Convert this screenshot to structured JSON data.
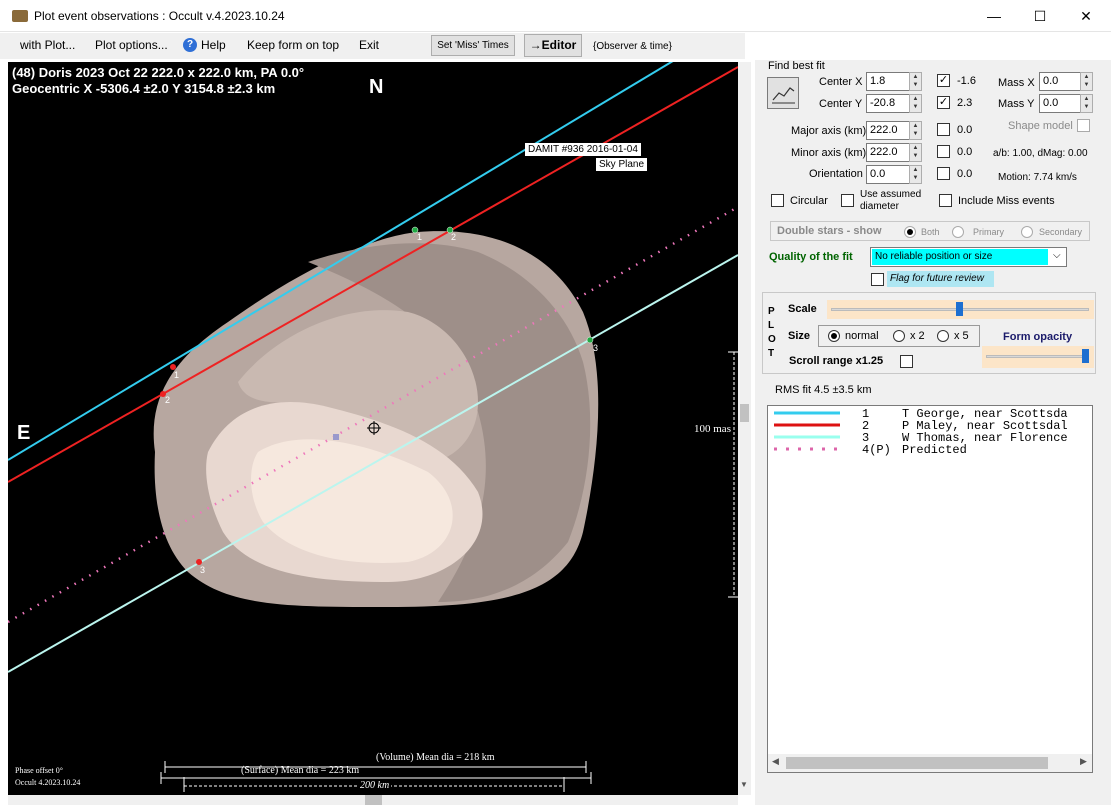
{
  "window": {
    "title": "Plot event observations : Occult v.4.2023.10.24",
    "minimize_glyph": "—",
    "maximize_glyph": "☐",
    "close_glyph": "✕"
  },
  "menu": {
    "with_plot": "with Plot...",
    "plot_options": "Plot options...",
    "help": "Help",
    "keep_on_top": "Keep form on top",
    "exit": "Exit",
    "set_miss_times": "Set 'Miss' Times",
    "editor": "→Editor",
    "observer_time": "{Observer & time}"
  },
  "plot": {
    "header_line1": "(48) Doris  2023 Oct 22   222.0 x 222.0 km, PA 0.0°",
    "header_line2": "Geocentric  X  -5306.4 ±2.0  Y 3154.8 ±2.3 km",
    "north": "N",
    "east": "E",
    "damit_label": "DAMIT #936 2016-01-04",
    "sky_plane": "Sky Plane",
    "scale_label": "100 mas",
    "volume_dia": "(Volume) Mean dia = 218 km",
    "surface_dia": "(Surface) Mean dia = 223 km",
    "km_scale": "200 km",
    "phase_offset": "Phase offset 0°",
    "version": "Occult 4.2023.10.24",
    "chord_labels": [
      "1",
      "2",
      "1",
      "2",
      "3",
      "3"
    ]
  },
  "fit": {
    "find_best_fit": "Find best fit",
    "center_x_label": "Center X",
    "center_x": "1.8",
    "center_y_label": "Center Y",
    "center_y": "-20.8",
    "cx_check": "-1.6",
    "cy_check": "2.3",
    "major_axis_label": "Major axis (km)",
    "major_axis": "222.0",
    "minor_axis_label": "Minor axis (km)",
    "minor_axis": "222.0",
    "orientation_label": "Orientation",
    "orientation": "0.0",
    "major_check": "0.0",
    "minor_check": "0.0",
    "orient_check": "0.0",
    "mass_x_label": "Mass X",
    "mass_x": "0.0",
    "mass_y_label": "Mass Y",
    "mass_y": "0.0",
    "shape_model": "Shape model",
    "ab_dmag": "a/b: 1.00, dMag: 0.00",
    "motion": "Motion: 7.74 km/s",
    "circular": "Circular",
    "use_assumed_1": "Use assumed",
    "use_assumed_2": "diameter",
    "include_miss": "Include Miss events",
    "double_stars": "Double stars - show",
    "both": "Both",
    "primary": "Primary",
    "secondary": "Secondary",
    "quality_label": "Quality of the fit",
    "quality_value": "No reliable position or size",
    "flag_review": "Flag for future review"
  },
  "plotpanel": {
    "vertical_label": [
      "P",
      "L",
      "O",
      "T"
    ],
    "scale": "Scale",
    "size": "Size",
    "normal": "normal",
    "x2": "x 2",
    "x5": "x 5",
    "form_opacity": "Form opacity",
    "scroll_range": "Scroll range x1.25"
  },
  "rms": "RMS fit 4.5 ±3.5 km",
  "legend": [
    {
      "num": "1",
      "text": "T George, near Scottsda",
      "color": "#33ccee",
      "style": "solid"
    },
    {
      "num": "2",
      "text": "P Maley, near Scottsdal",
      "color": "#dd1111",
      "style": "solid"
    },
    {
      "num": "3",
      "text": "W Thomas, near Florence",
      "color": "#99ffee",
      "style": "solid"
    },
    {
      "num": "4(P)",
      "text": "Predicted",
      "color": "#dd66aa",
      "style": "dotted"
    }
  ],
  "colors": {
    "chord1": "#33ccee",
    "chord2": "#ee2222",
    "chord3": "#bbf5ee",
    "predicted": "#ee77bb",
    "quality_bg": "#00ffff",
    "fit_label": "#006400"
  }
}
